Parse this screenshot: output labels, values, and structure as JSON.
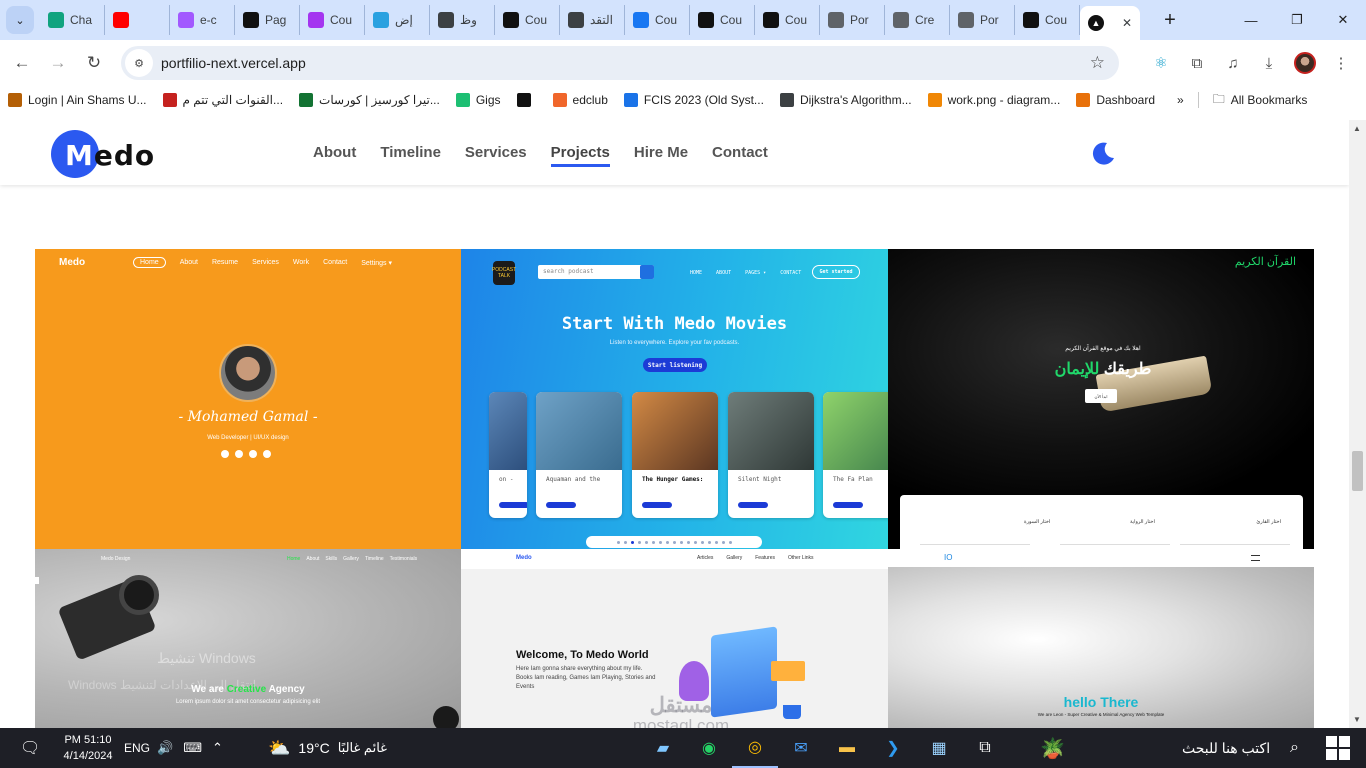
{
  "browser": {
    "tabs": [
      {
        "label": "Cha",
        "icon": "chatgpt-icon",
        "color": "#10a37f"
      },
      {
        "label": "",
        "icon": "youtube-icon",
        "color": "#ff0000"
      },
      {
        "label": "e-c",
        "icon": "figma-icon",
        "color": "#a259ff"
      },
      {
        "label": "Pag",
        "icon": "play-icon",
        "color": "#111111"
      },
      {
        "label": "Cou",
        "icon": "udemy-icon",
        "color": "#a435f0"
      },
      {
        "label": "إض",
        "icon": "circle-app-icon",
        "color": "#2aa1e0"
      },
      {
        "label": "وظ",
        "icon": "briefcase-icon",
        "color": "#3c4043"
      },
      {
        "label": "Cou",
        "icon": "coursera-icon",
        "color": "#111111"
      },
      {
        "label": "التقد",
        "icon": "briefcase-icon",
        "color": "#3c4043"
      },
      {
        "label": "Cou",
        "icon": "facebook-icon",
        "color": "#1877f2"
      },
      {
        "label": "Cou",
        "icon": "coursera-icon",
        "color": "#111111"
      },
      {
        "label": "Cou",
        "icon": "coursera-icon",
        "color": "#111111"
      },
      {
        "label": "Por",
        "icon": "vercel-icon",
        "color": "#5f6368"
      },
      {
        "label": "Cre",
        "icon": "globe-icon",
        "color": "#5f6368"
      },
      {
        "label": "Por",
        "icon": "vercel-icon",
        "color": "#5f6368"
      },
      {
        "label": "Cou",
        "icon": "coursera-icon",
        "color": "#111111"
      }
    ],
    "active_tab": {
      "label": "",
      "icon": "vercel-triangle-icon"
    },
    "url": "portfilio-next.vercel.app",
    "bookmarks": [
      {
        "label": "Login | Ain Shams U...",
        "icon": "university-icon",
        "color": "#b45f06"
      },
      {
        "label": "القنوات التي تتم م...",
        "icon": "youtube-studio-icon",
        "color": "#c5221f"
      },
      {
        "label": "تيرا كورسيز | كورسات...",
        "icon": "tera-icon",
        "color": "#137333"
      },
      {
        "label": "Gigs",
        "icon": "fiverr-icon",
        "color": "#1dbf73"
      },
      {
        "label": "",
        "icon": "github-icon",
        "color": "#111111"
      },
      {
        "label": "edclub",
        "icon": "edclub-icon",
        "color": "#f0662b"
      },
      {
        "label": "FCIS 2023 (Old Syst...",
        "icon": "drive-icon",
        "color": "#1a73e8"
      },
      {
        "label": "Dijkstra's Algorithm...",
        "icon": "dijkstra-icon",
        "color": "#3c4043"
      },
      {
        "label": "work.png - diagram...",
        "icon": "drawio-icon",
        "color": "#f08705"
      },
      {
        "label": "Dashboard",
        "icon": "dashboard-icon",
        "color": "#e8710a"
      }
    ],
    "all_bookmarks": "All Bookmarks"
  },
  "site": {
    "logo": {
      "first": "M",
      "rest": "edo"
    },
    "nav": [
      "About",
      "Timeline",
      "Services",
      "Projects",
      "Hire Me",
      "Contact"
    ],
    "active_nav": "Projects",
    "accent": "#2b59f0"
  },
  "projects": {
    "portfolio": {
      "brand": "Medo",
      "links": [
        "Home",
        "About",
        "Resume",
        "Services",
        "Work",
        "Contact",
        "Settings ▾"
      ],
      "name": "- Mohamed Gamal -",
      "role": "Web Developer | UI/UX design",
      "bg": "#f79a1c"
    },
    "movies": {
      "logo": "PODCAST TALK",
      "search_placeholder": "search podcast",
      "links": [
        "HOME",
        "ABOUT",
        "PAGES ▾",
        "CONTACT"
      ],
      "cta": "Get started",
      "title": "Start With Medo Movies",
      "subtitle": "Listen to everywhere. Explore your fav podcasts.",
      "button": "Start listening",
      "cards": [
        {
          "title": "on -",
          "active": false
        },
        {
          "title": "Aquaman and the",
          "active": false
        },
        {
          "title": "The Hunger Games:",
          "active": true
        },
        {
          "title": "Silent Night",
          "active": false
        },
        {
          "title": "The Fa Plan",
          "active": false
        }
      ]
    },
    "quran": {
      "brand": "القرآن الكريم",
      "welcome": "اهلا بك في موقع القرآن الكريم",
      "title_white": "طريقك",
      "title_green": "للإيمان",
      "button": "ابدأ الآن",
      "labels": [
        "اختار القارئ",
        "اختار الرواية",
        "اختار السورة"
      ]
    },
    "design": {
      "brand": "Medo Design",
      "links": [
        "Home",
        "About",
        "Skills",
        "Gallery",
        "Timeline",
        "Testimonials"
      ],
      "heading_a": "We are",
      "heading_b": "Creative",
      "heading_c": "Agency",
      "sub": "Lorem ipsum dolor sit amet consectetur adipisicing elit",
      "watermark1": "تنشيط Windows",
      "watermark2": "Windows انتقل إلى الإعدادات لتنشيط"
    },
    "world": {
      "brand": "Medo",
      "links": [
        "Articles",
        "Gallery",
        "Features",
        "Other Links"
      ],
      "title": "Welcome, To Medo World",
      "desc": "Here Iam gonna share everything about my life. Books Iam reading, Games Iam Playing, Stories and Events",
      "watermark": "مستقل",
      "watermark_url": "mostaql.com"
    },
    "agency": {
      "brand": "IO",
      "title": "hello There",
      "sub": "We are Leon - Super Creative & Minimal Agency Web Template"
    }
  },
  "taskbar": {
    "time": "PM 51:10",
    "date": "4/14/2024",
    "lang": "ENG",
    "temp": "19°C",
    "weather": "غائم غالبًا",
    "search": "اكتب هنا للبحث"
  }
}
